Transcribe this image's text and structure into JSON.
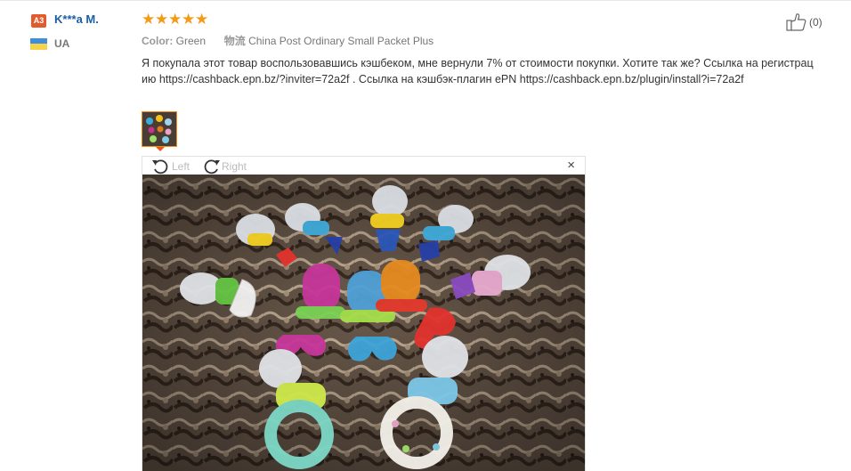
{
  "user": {
    "badge": "A3",
    "name": "K***a M.",
    "country": "UA"
  },
  "review": {
    "rating": 5,
    "stars": [
      "★",
      "★",
      "★",
      "★",
      "★"
    ],
    "color_label": "Color:",
    "color_value": "Green",
    "shipping_label": "物流",
    "shipping_value": "China Post Ordinary Small Packet Plus",
    "text": "Я покупала этот товар воспользовавшись кэшбеком, мне вернули 7% от стоимости покупки. Хотите так же? Ссылка на регистрацию https://cashback.epn.bz/?inviter=72a2f . Ссылка на кэшбэк-плагин ePN https://cashback.epn.bz/plugin/install?i=72a2f",
    "helpful_count": "(0)"
  },
  "viewer": {
    "rotate_left_label": "Left",
    "rotate_right_label": "Right",
    "close_glyph": "×"
  },
  "icons": {
    "like": "thumbs-up-icon",
    "rotate_left": "rotate-left-icon",
    "rotate_right": "rotate-right-icon",
    "close": "close-icon"
  },
  "colors": {
    "username": "#1a5ea5",
    "star": "#f39a17",
    "badge": "#e25b2c",
    "thumb_border": "#f18b1a"
  }
}
